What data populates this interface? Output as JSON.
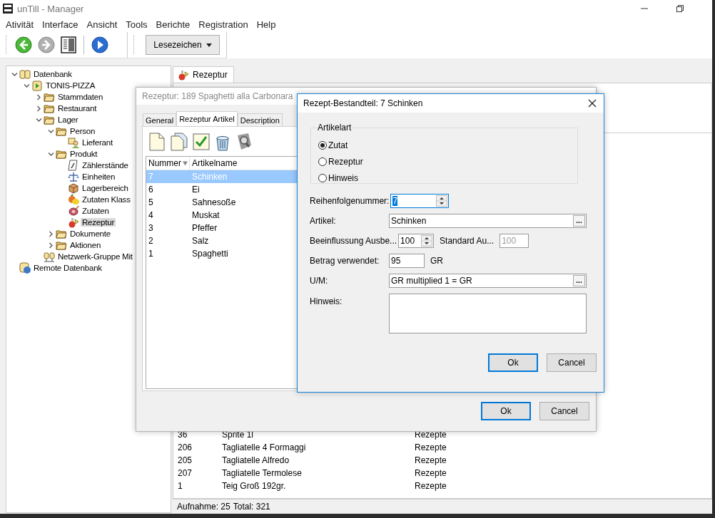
{
  "window": {
    "title": "unTill - Manager"
  },
  "menu": [
    "Ativität",
    "Interface",
    "Ansicht",
    "Tools",
    "Berichte",
    "Registration",
    "Help"
  ],
  "toolbar": {
    "bookmarks": "Lesezeichen"
  },
  "tree": [
    {
      "label": "Datenbank",
      "kind": "database",
      "expanded": true,
      "selected": false,
      "children": [
        {
          "label": "TONIS-PIZZA",
          "kind": "connection",
          "expanded": true,
          "selected": false,
          "children": [
            {
              "label": "Stammdaten",
              "kind": "folder",
              "expanded": false,
              "selected": false
            },
            {
              "label": "Restaurant",
              "kind": "folder",
              "expanded": false,
              "selected": false
            },
            {
              "label": "Lager",
              "kind": "folder",
              "expanded": true,
              "selected": false,
              "children": [
                {
                  "label": "Person",
                  "kind": "folder",
                  "expanded": true,
                  "selected": false,
                  "children": [
                    {
                      "label": "Lieferant",
                      "kind": "supplier",
                      "selected": false
                    }
                  ]
                },
                {
                  "label": "Produkt",
                  "kind": "folder",
                  "expanded": true,
                  "selected": false,
                  "children": [
                    {
                      "label": "Zählerstände",
                      "kind": "meter",
                      "selected": false
                    },
                    {
                      "label": "Einheiten",
                      "kind": "unit",
                      "selected": false
                    },
                    {
                      "label": "Lagerbereich",
                      "kind": "storage",
                      "selected": false
                    },
                    {
                      "label": "Zutaten Klass",
                      "kind": "category",
                      "selected": false
                    },
                    {
                      "label": "Zutaten",
                      "kind": "ingredient",
                      "selected": false
                    },
                    {
                      "label": "Rezeptur",
                      "kind": "recipe",
                      "selected": true
                    }
                  ]
                },
                {
                  "label": "Dokumente",
                  "kind": "folder",
                  "expanded": false,
                  "selected": false
                },
                {
                  "label": "Aktionen",
                  "kind": "folder",
                  "expanded": false,
                  "selected": false
                }
              ]
            },
            {
              "label": "Netzwerk-Gruppe Mit",
              "kind": "network",
              "selected": false
            }
          ]
        }
      ]
    },
    {
      "label": "Remote Datenbank",
      "kind": "remote",
      "selected": false
    }
  ],
  "tabs": [
    {
      "label": "Rezeptur",
      "selected": true
    }
  ],
  "list": {
    "rows": [
      {
        "number": "36",
        "name": "Sprite 1l",
        "category": "Rezepte"
      },
      {
        "number": "206",
        "name": "Tagliatelle 4 Formaggi",
        "category": "Rezepte"
      },
      {
        "number": "205",
        "name": "Tagliatelle Alfredo",
        "category": "Rezepte"
      },
      {
        "number": "207",
        "name": "Tagliatelle Termolese",
        "category": "Rezepte"
      },
      {
        "number": "1",
        "name": "Teig Groß 192gr.",
        "category": "Rezepte"
      }
    ]
  },
  "status_bar": {
    "records": "Aufnahme: 25",
    "total": "Total: 321"
  },
  "recipe_dialog": {
    "title": "Rezeptur: 189 Spaghetti alla Carbonara",
    "active": false,
    "tabs": [
      {
        "label": "General",
        "selected": false
      },
      {
        "label": "Rezeptur Artikel",
        "selected": true
      },
      {
        "label": "Description",
        "selected": false
      }
    ],
    "columns": [
      "Nummer",
      "Artikelname"
    ],
    "rows": [
      {
        "number": "7",
        "name": "Schinken",
        "selected": true
      },
      {
        "number": "6",
        "name": "Ei",
        "selected": false
      },
      {
        "number": "5",
        "name": "Sahnesoße",
        "selected": false
      },
      {
        "number": "4",
        "name": "Muskat",
        "selected": false
      },
      {
        "number": "3",
        "name": "Pfeffer",
        "selected": false
      },
      {
        "number": "2",
        "name": "Salz",
        "selected": false
      },
      {
        "number": "1",
        "name": "Spaghetti",
        "selected": false
      }
    ],
    "buttons": [
      {
        "label": "Ok",
        "default": true
      },
      {
        "label": "Cancel",
        "default": false
      }
    ]
  },
  "component_dialog": {
    "title": "Rezept-Bestandteil: 7 Schinken",
    "active": true,
    "group": "Artikelart",
    "types": [
      {
        "label": "Zutat",
        "selected": true
      },
      {
        "label": "Rezeptur",
        "selected": false
      },
      {
        "label": "Hinweis",
        "selected": false
      }
    ],
    "fields": [
      {
        "kind": "spinner",
        "label": "Reihenfolgenummer:",
        "value": "7",
        "focused": true
      },
      {
        "kind": "lookup",
        "label": "Artikel:",
        "value": "Schinken",
        "button": "...",
        "focused": false
      },
      {
        "kind": "spinner",
        "label": "Beeinflussung Ausbe...",
        "value": "100",
        "focused": false,
        "extra_label": "Standard Au...",
        "extra_value": "100"
      },
      {
        "kind": "amount",
        "label": "Betrag verwendet:",
        "value": "95",
        "unit": "GR",
        "focused": false
      },
      {
        "kind": "lookup",
        "label": "U/M:",
        "value": "GR multiplied 1 = GR",
        "button": "...",
        "focused": false
      },
      {
        "kind": "memo",
        "label": "Hinweis:",
        "focused": false
      }
    ],
    "buttons": [
      {
        "label": "Ok",
        "default": true
      },
      {
        "label": "Cancel",
        "default": false
      }
    ]
  }
}
